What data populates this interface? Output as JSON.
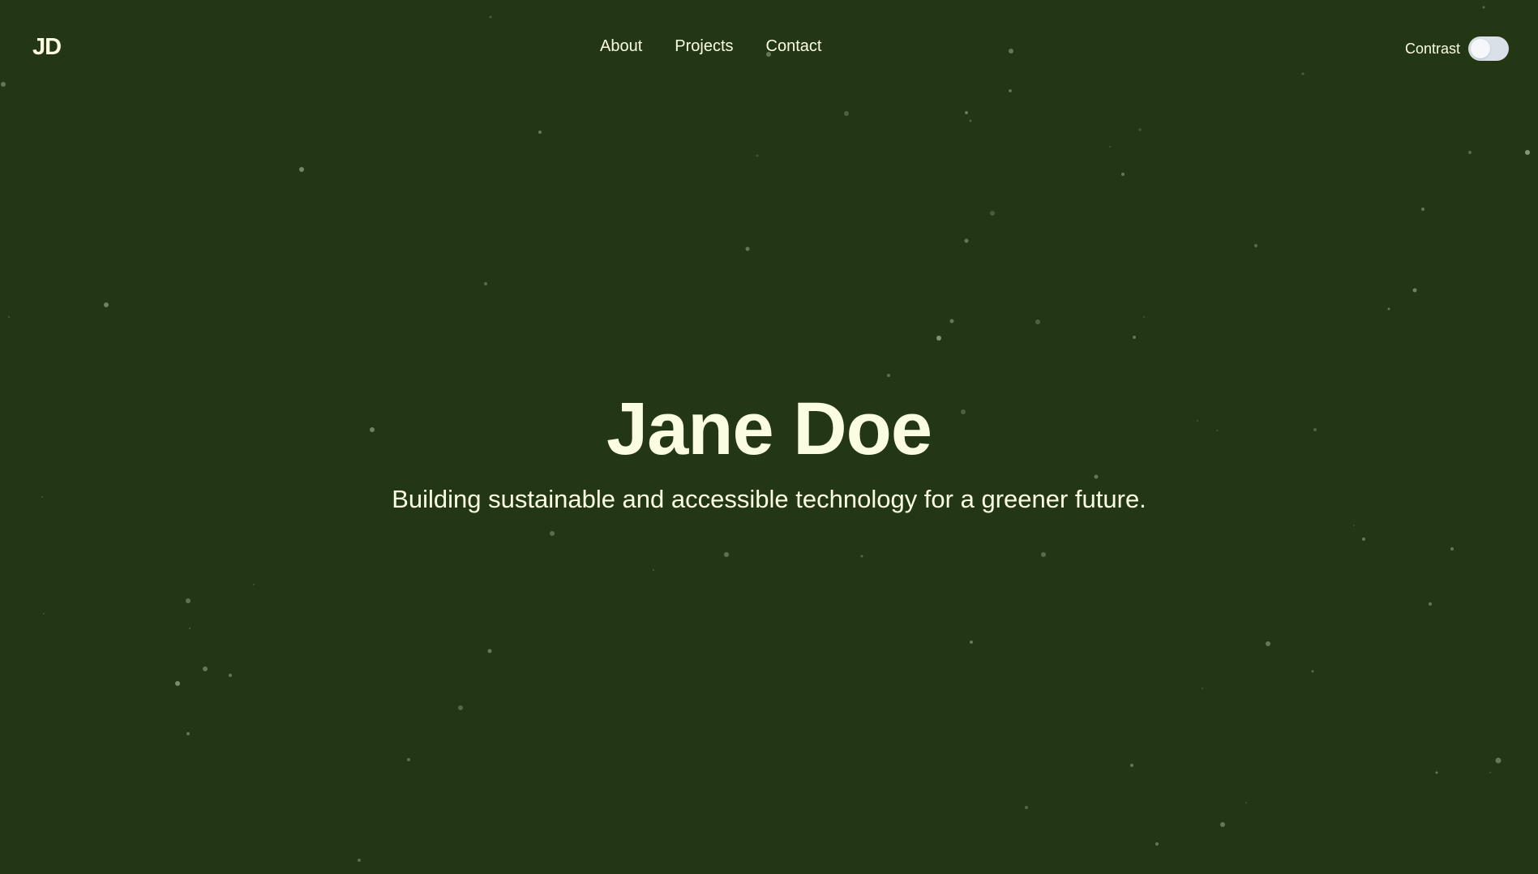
{
  "header": {
    "logo": "JD",
    "nav": [
      {
        "label": "About"
      },
      {
        "label": "Projects"
      },
      {
        "label": "Contact"
      }
    ],
    "contrast_label": "Contrast",
    "contrast_enabled": false
  },
  "hero": {
    "name": "Jane Doe",
    "tagline": "Building sustainable and accessible technology for a greener future."
  },
  "theme": {
    "background": "#233714",
    "text": "#fbfde3",
    "particle": "#8fa384",
    "toggle_track": "#d9e0e8"
  }
}
